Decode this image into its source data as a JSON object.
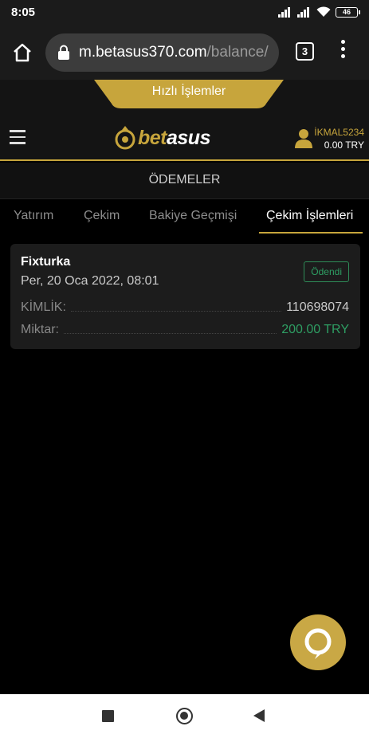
{
  "status_bar": {
    "time": "8:05",
    "battery": "46"
  },
  "browser": {
    "url_host": "m.betasus370.com",
    "url_path": "/balance/",
    "tab_count": "3"
  },
  "header": {
    "quick_actions_label": "Hızlı İşlemler",
    "logo_text_left": "bet",
    "logo_text_right": "asus",
    "username": "İKMAL5234",
    "balance": "0.00 TRY"
  },
  "section_title": "ÖDEMELER",
  "subtabs": [
    {
      "label": "Yatırım",
      "active": false
    },
    {
      "label": "Çekim",
      "active": false
    },
    {
      "label": "Bakiye Geçmişi",
      "active": false
    },
    {
      "label": "Çekim İşlemleri",
      "active": true
    }
  ],
  "transaction": {
    "method": "Fixturka",
    "date": "Per, 20 Oca 2022, 08:01",
    "status": "Ödendi",
    "id_label": "KİMLİK:",
    "id_value": "110698074",
    "amount_label": "Miktar:",
    "amount_value": "200.00 TRY"
  },
  "colors": {
    "accent_gold": "#c7a53c",
    "success_green": "#2e9e63",
    "background": "#000000"
  },
  "icons": [
    "home-icon",
    "lock-icon",
    "tabs-icon",
    "more-vert-icon",
    "hamburger-icon",
    "logo-icon",
    "user-icon",
    "chat-icon",
    "nav-recents-icon",
    "nav-home-icon",
    "nav-back-icon"
  ]
}
